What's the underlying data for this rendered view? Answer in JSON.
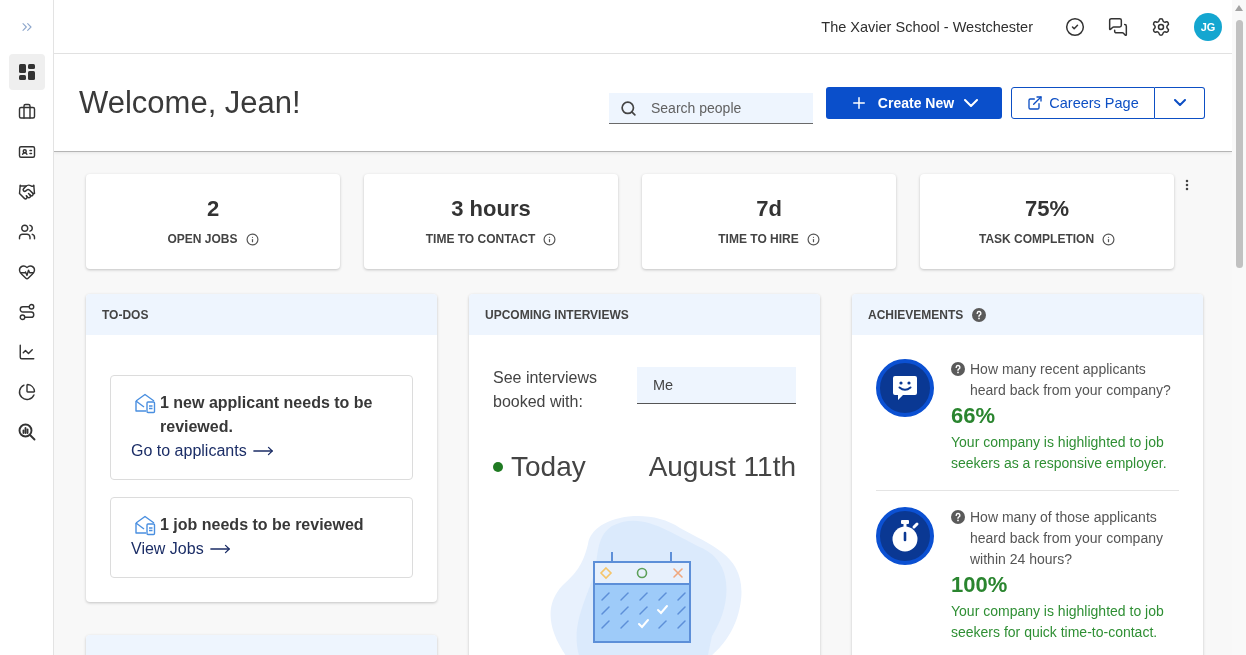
{
  "sidebar": {
    "items": [
      {
        "selected": true
      },
      {
        "selected": false
      },
      {
        "selected": false
      },
      {
        "selected": false
      },
      {
        "selected": false
      },
      {
        "selected": false
      },
      {
        "selected": false
      },
      {
        "selected": false
      },
      {
        "selected": false
      },
      {
        "selected": false
      }
    ]
  },
  "top_bar": {
    "organization": "The Xavier School - Westchester",
    "avatar_initials": "JG"
  },
  "header": {
    "greeting": "Welcome, Jean!",
    "search": {
      "placeholder": "Search people"
    },
    "create_button": "Create New",
    "careers_button": "Careers Page"
  },
  "stats": [
    {
      "value": "2",
      "label": "OPEN JOBS"
    },
    {
      "value": "3 hours",
      "label": "TIME TO CONTACT"
    },
    {
      "value": "7d",
      "label": "TIME TO HIRE"
    },
    {
      "value": "75%",
      "label": "TASK COMPLETION"
    }
  ],
  "todos": {
    "title": "TO-DOS",
    "items": [
      {
        "text": "1 new applicant needs to be reviewed.",
        "link": "Go to applicants"
      },
      {
        "text": "1 job needs to be reviewed",
        "link": "View Jobs"
      }
    ]
  },
  "upcoming_interviews": {
    "title": "UPCOMING INTERVIEWS",
    "filter_label": "See interviews booked with:",
    "filter_value": "Me",
    "day": "Today",
    "date": "August 11th"
  },
  "achievements": {
    "title": "ACHIEVEMENTS",
    "items": [
      {
        "question": "How many recent applicants heard back from your company?",
        "value": "66%",
        "description": "Your company is highlighted to job seekers as a responsive employer."
      },
      {
        "question": "How many of those applicants heard back from your company within 24 hours?",
        "value": "100%",
        "description": "Your company is highlighted to job seekers for quick time-to-contact."
      }
    ]
  }
}
